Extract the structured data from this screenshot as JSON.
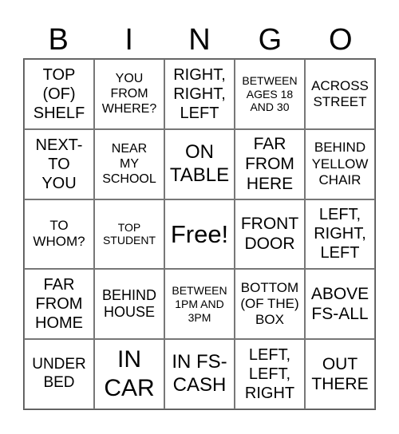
{
  "header": [
    "B",
    "I",
    "N",
    "G",
    "O"
  ],
  "cells": [
    {
      "text": "TOP\n(OF)\nSHELF",
      "size": 20
    },
    {
      "text": "YOU\nFROM\nWHERE?",
      "size": 16
    },
    {
      "text": "RIGHT,\nRIGHT,\nLEFT",
      "size": 20
    },
    {
      "text": "BETWEEN\nAGES 18\nAND 30",
      "size": 14
    },
    {
      "text": "ACROSS\nSTREET",
      "size": 17
    },
    {
      "text": "NEXT-\nTO\nYOU",
      "size": 20
    },
    {
      "text": "NEAR\nMY\nSCHOOL",
      "size": 16
    },
    {
      "text": "ON\nTABLE",
      "size": 24
    },
    {
      "text": "FAR\nFROM\nHERE",
      "size": 21
    },
    {
      "text": "BEHIND\nYELLOW\nCHAIR",
      "size": 17
    },
    {
      "text": "TO\nWHOM?",
      "size": 17
    },
    {
      "text": "TOP\nSTUDENT",
      "size": 14
    },
    {
      "text": "Free!",
      "size": 31
    },
    {
      "text": "FRONT\nDOOR",
      "size": 21
    },
    {
      "text": "LEFT,\nRIGHT,\nLEFT",
      "size": 20
    },
    {
      "text": "FAR\nFROM\nHOME",
      "size": 20
    },
    {
      "text": "BEHIND\nHOUSE",
      "size": 18
    },
    {
      "text": "BETWEEN\n1PM AND\n3PM",
      "size": 14
    },
    {
      "text": "BOTTOM\n(OF THE)\nBOX",
      "size": 17
    },
    {
      "text": "ABOVE\nFS-ALL",
      "size": 21
    },
    {
      "text": "UNDER\nBED",
      "size": 19
    },
    {
      "text": "IN\nCAR",
      "size": 30
    },
    {
      "text": "IN FS-\nCASH",
      "size": 24
    },
    {
      "text": "LEFT,\nLEFT,\nRIGHT",
      "size": 20
    },
    {
      "text": "OUT\nTHERE",
      "size": 21
    }
  ]
}
